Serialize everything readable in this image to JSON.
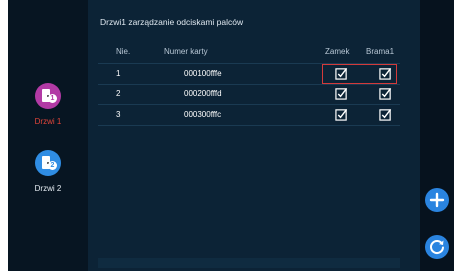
{
  "colors": {
    "screen_bg": "#05101c",
    "panel_bg": "#0c2336",
    "door1_icon": "#b23aa5",
    "door2_icon": "#2f8de4",
    "active_label": "#e2453a",
    "inactive_label": "#e6edf3",
    "checkbox": "#ffffff",
    "selection_border": "#d43a3a",
    "fab": "#2a84e0"
  },
  "sidebar": {
    "doors": [
      {
        "label": "Drzwi 1",
        "number": "1",
        "icon": "door-icon",
        "active": true
      },
      {
        "label": "Drzwi 2",
        "number": "2",
        "icon": "door-icon",
        "active": false
      }
    ]
  },
  "main": {
    "title": "Drzwi1 zarządzanie odciskami palców",
    "columns": {
      "no": "Nie.",
      "card": "Numer karty",
      "lock": "Zamek",
      "gate": "Brama1"
    },
    "rows": [
      {
        "no": "1",
        "card": "000100fffe",
        "lock": true,
        "gate": true
      },
      {
        "no": "2",
        "card": "000200fffd",
        "lock": true,
        "gate": true
      },
      {
        "no": "3",
        "card": "000300fffc",
        "lock": true,
        "gate": true
      }
    ]
  },
  "actions": {
    "add": {
      "icon": "plus-icon"
    },
    "refresh": {
      "icon": "refresh-icon"
    }
  }
}
